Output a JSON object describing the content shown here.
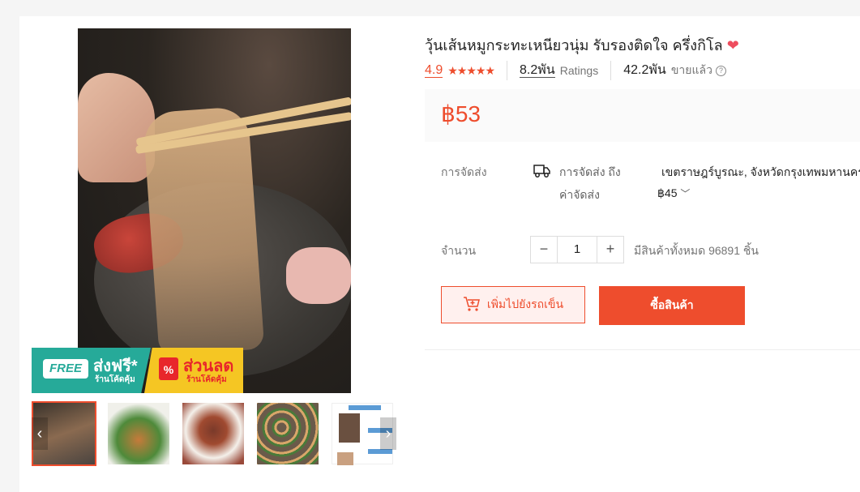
{
  "product": {
    "title": "วุ้นเส้นหมูกระทะเหนียวนุ่ม รับรองติดใจ ครึ่งกิโล",
    "rating": "4.9",
    "stars": "★★★★★",
    "ratings_count": "8.2พัน",
    "ratings_label": "Ratings",
    "sold_count": "42.2พัน",
    "sold_label": "ขายแล้ว",
    "price": "฿53"
  },
  "banner": {
    "free_badge": "FREE",
    "free_title": "ส่งฟรี*",
    "free_sub": "ร้านโค้ดคุ้ม",
    "discount_icon": "%",
    "discount_title": "ส่วนลด",
    "discount_sub": "ร้านโค้ดคุ้ม"
  },
  "shipping": {
    "label": "การจัดส่ง",
    "to_label": "การจัดส่ง ถึง",
    "destination": "เขตราษฎร์บูรณะ, จังหวัดกรุงเทพมหานคร",
    "fee_label": "ค่าจัดส่ง",
    "fee": "฿45"
  },
  "quantity": {
    "label": "จำนวน",
    "minus": "−",
    "value": "1",
    "plus": "+",
    "stock_text": "มีสินค้าทั้งหมด 96891 ชิ้น"
  },
  "actions": {
    "add_to_cart": "เพิ่มไปยังรถเข็น",
    "buy_now": "ซื้อสินค้า"
  },
  "icons": {
    "heart": "heart-icon",
    "help": "help-icon",
    "truck": "truck-icon",
    "cart": "cart-icon",
    "chevron": "chevron-down-icon"
  },
  "colors": {
    "accent": "#ee4d2d",
    "free_shipping": "#26aa99",
    "discount": "#f5c623"
  }
}
